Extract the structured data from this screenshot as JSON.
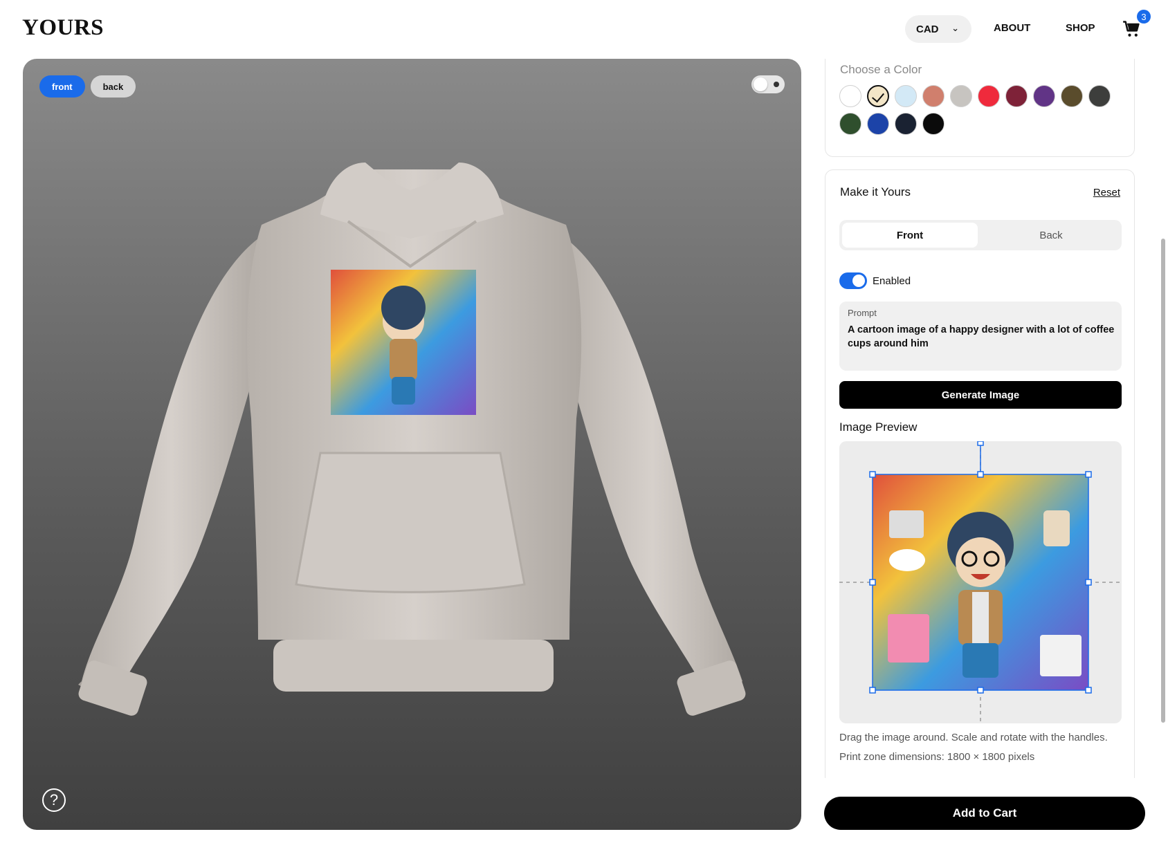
{
  "header": {
    "logo": "YOURS",
    "currency": "CAD",
    "nav": [
      "ABOUT",
      "SHOP"
    ],
    "cart_count": "3"
  },
  "viewer": {
    "view_options": [
      "front",
      "back"
    ],
    "active_view": "front",
    "help_symbol": "?"
  },
  "color_picker": {
    "title": "Choose a Color",
    "swatches": [
      "#ffffff",
      "#f3e6c8",
      "#d3e9f6",
      "#d07f6d",
      "#c7c4c0",
      "#ef2a3c",
      "#7e2238",
      "#613486",
      "#5a4c2c",
      "#3d3e3c",
      "#2f4f2d",
      "#1c43a8",
      "#1a2232",
      "#0b0b0b"
    ],
    "selected_swatch": "#f3e6c8"
  },
  "customize": {
    "title": "Make it Yours",
    "reset": "Reset",
    "side_options": [
      "Front",
      "Back"
    ],
    "active_side": "Front",
    "enabled_label": "Enabled",
    "enabled": true,
    "prompt_label": "Prompt",
    "prompt_text": "A cartoon image of a happy designer with a lot of coffee cups around him",
    "generate_label": "Generate Image",
    "preview_title": "Image Preview",
    "hint_drag": "Drag the image around. Scale and rotate with the handles.",
    "hint_dimensions": "Print zone dimensions: 1800 × 1800 pixels"
  },
  "add_to_cart": "Add to Cart",
  "colors": {
    "accent": "#1a6bea",
    "primary_button": "#000000",
    "hoodie": "#cfc9c4"
  }
}
